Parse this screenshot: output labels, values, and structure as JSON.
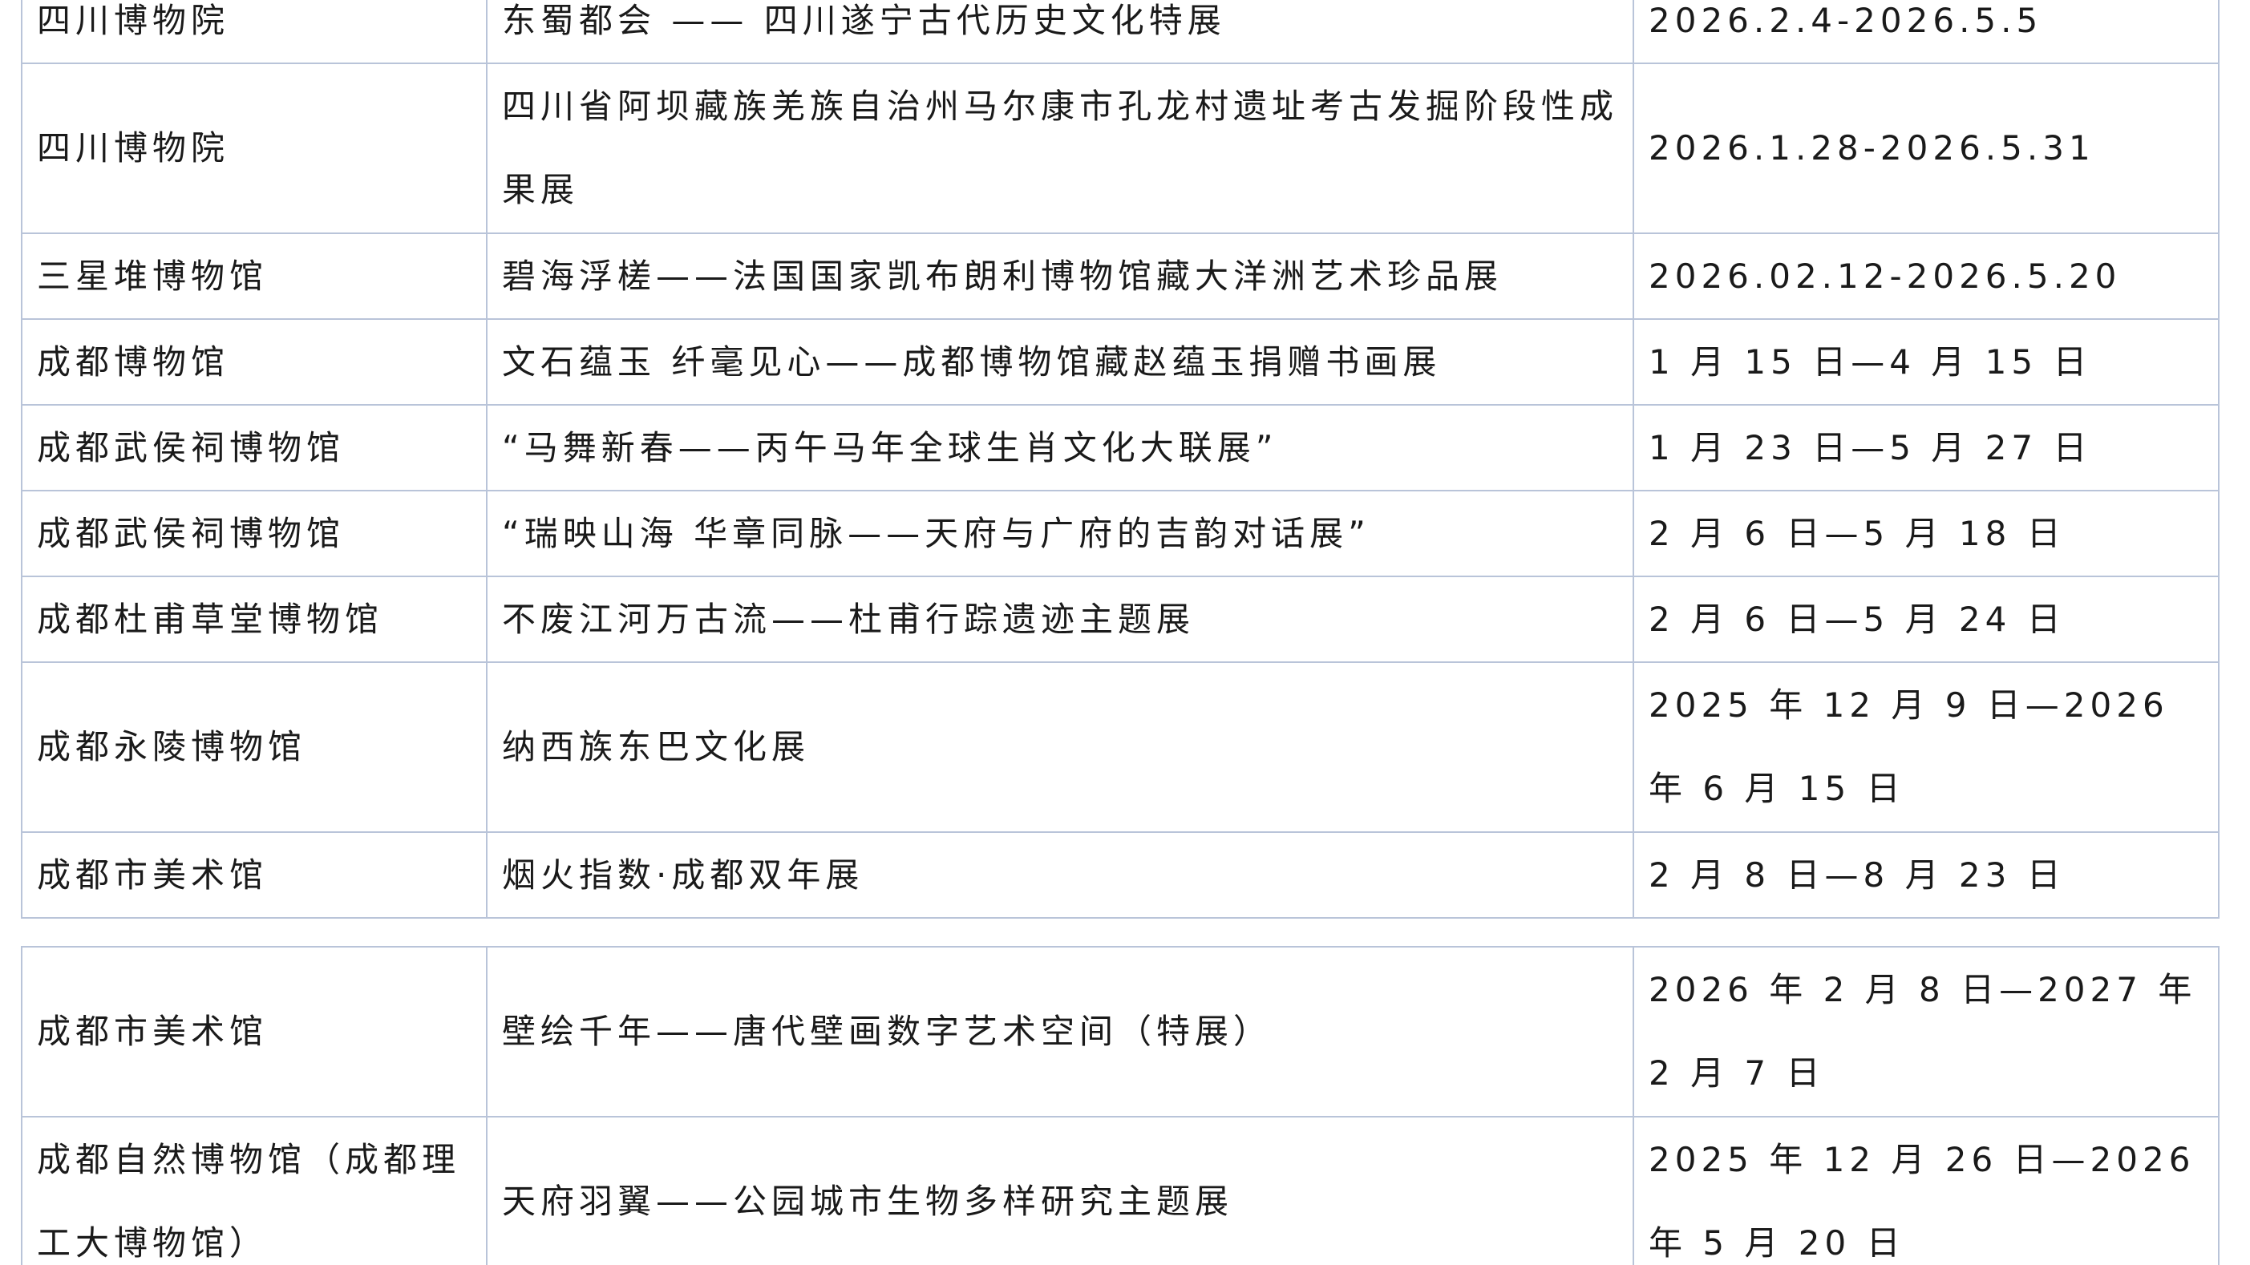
{
  "tables": [
    {
      "rows": [
        {
          "venue": "四川博物院",
          "title": "东蜀都会 —— 四川遂宁古代历史文化特展",
          "date": "2026.2.4-2026.5.5"
        },
        {
          "venue": "四川博物院",
          "title": "四川省阿坝藏族羌族自治州马尔康市孔龙村遗址考古发掘阶段性成果展",
          "date": "2026.1.28-2026.5.31"
        },
        {
          "venue": "三星堆博物馆",
          "title": "碧海浮槎——法国国家凯布朗利博物馆藏大洋洲艺术珍品展",
          "date": "2026.02.12-2026.5.20"
        },
        {
          "venue": "成都博物馆",
          "title": "文石蕴玉 纤毫见心——成都博物馆藏赵蕴玉捐赠书画展",
          "date": "1 月 15 日—4 月 15 日"
        },
        {
          "venue": "成都武侯祠博物馆",
          "title": "“马舞新春——丙午马年全球生肖文化大联展”",
          "date": "1 月 23 日—5 月 27 日"
        },
        {
          "venue": "成都武侯祠博物馆",
          "title": "“瑞映山海 华章同脉——天府与广府的吉韵对话展”",
          "date": "2 月 6 日—5 月 18 日"
        },
        {
          "venue": "成都杜甫草堂博物馆",
          "title": "不废江河万古流——杜甫行踪遗迹主题展",
          "date": "2 月 6 日—5 月 24 日"
        },
        {
          "venue": "成都永陵博物馆",
          "title": "纳西族东巴文化展",
          "date": "2025 年 12 月 9 日—2026 年 6 月 15 日"
        },
        {
          "venue": "成都市美术馆",
          "title": "烟火指数·成都双年展",
          "date": "2 月 8 日—8 月 23 日"
        }
      ]
    },
    {
      "rows": [
        {
          "venue": "成都市美术馆",
          "title": "壁绘千年——唐代壁画数字艺术空间（特展）",
          "date": "2026 年 2 月 8 日—2027 年 2 月 7 日"
        },
        {
          "venue": "成都自然博物馆（成都理工大博物馆）",
          "title": "天府羽翼——公园城市生物多样研究主题展",
          "date": "2025 年 12 月 26 日—2026 年 5 月 20 日"
        }
      ]
    }
  ]
}
